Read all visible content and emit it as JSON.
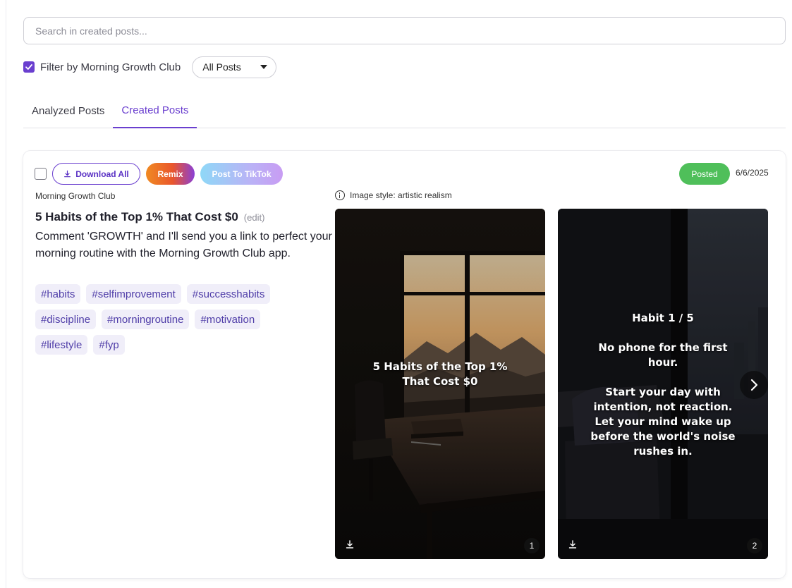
{
  "search": {
    "placeholder": "Search in created posts..."
  },
  "filter": {
    "label": "Filter by Morning Growth Club",
    "checked": true,
    "select_value": "All Posts"
  },
  "tabs": [
    {
      "label": "Analyzed Posts",
      "active": false
    },
    {
      "label": "Created Posts",
      "active": true
    }
  ],
  "post": {
    "buttons": {
      "download_all": "Download All",
      "remix": "Remix",
      "post_to_tiktok": "Post To TikTok"
    },
    "status": "Posted",
    "date": "6/6/2025",
    "account": "Morning Growth Club",
    "title": "5 Habits of the Top 1% That Cost $0",
    "edit_label": "(edit)",
    "caption": "Comment 'GROWTH' and I'll send you a link to perfect your morning routine with the Morning Growth Club app.",
    "hashtags": [
      "#habits",
      "#selfimprovement",
      "#successhabits",
      "#discipline",
      "#morningroutine",
      "#motivation",
      "#lifestyle",
      "#fyp"
    ],
    "image_style": "Image style: artistic realism",
    "slides": [
      {
        "number": "1",
        "text_lines": [
          "5 Habits of the Top 1%",
          "That Cost $0"
        ]
      },
      {
        "number": "2",
        "text_lines": [
          "Habit 1 / 5",
          "",
          "No phone for the first",
          "hour.",
          "",
          "Start your day with",
          "intention, not reaction.",
          "Let your mind wake up",
          "before the world's noise",
          "rushes in."
        ]
      }
    ]
  },
  "colors": {
    "accent": "#6a3fcf",
    "status_green": "#4fbf5a",
    "tag_bg": "#f0eef9"
  },
  "icons": {
    "download": "download-icon",
    "info": "info-icon",
    "next": "chevron-right-icon"
  }
}
